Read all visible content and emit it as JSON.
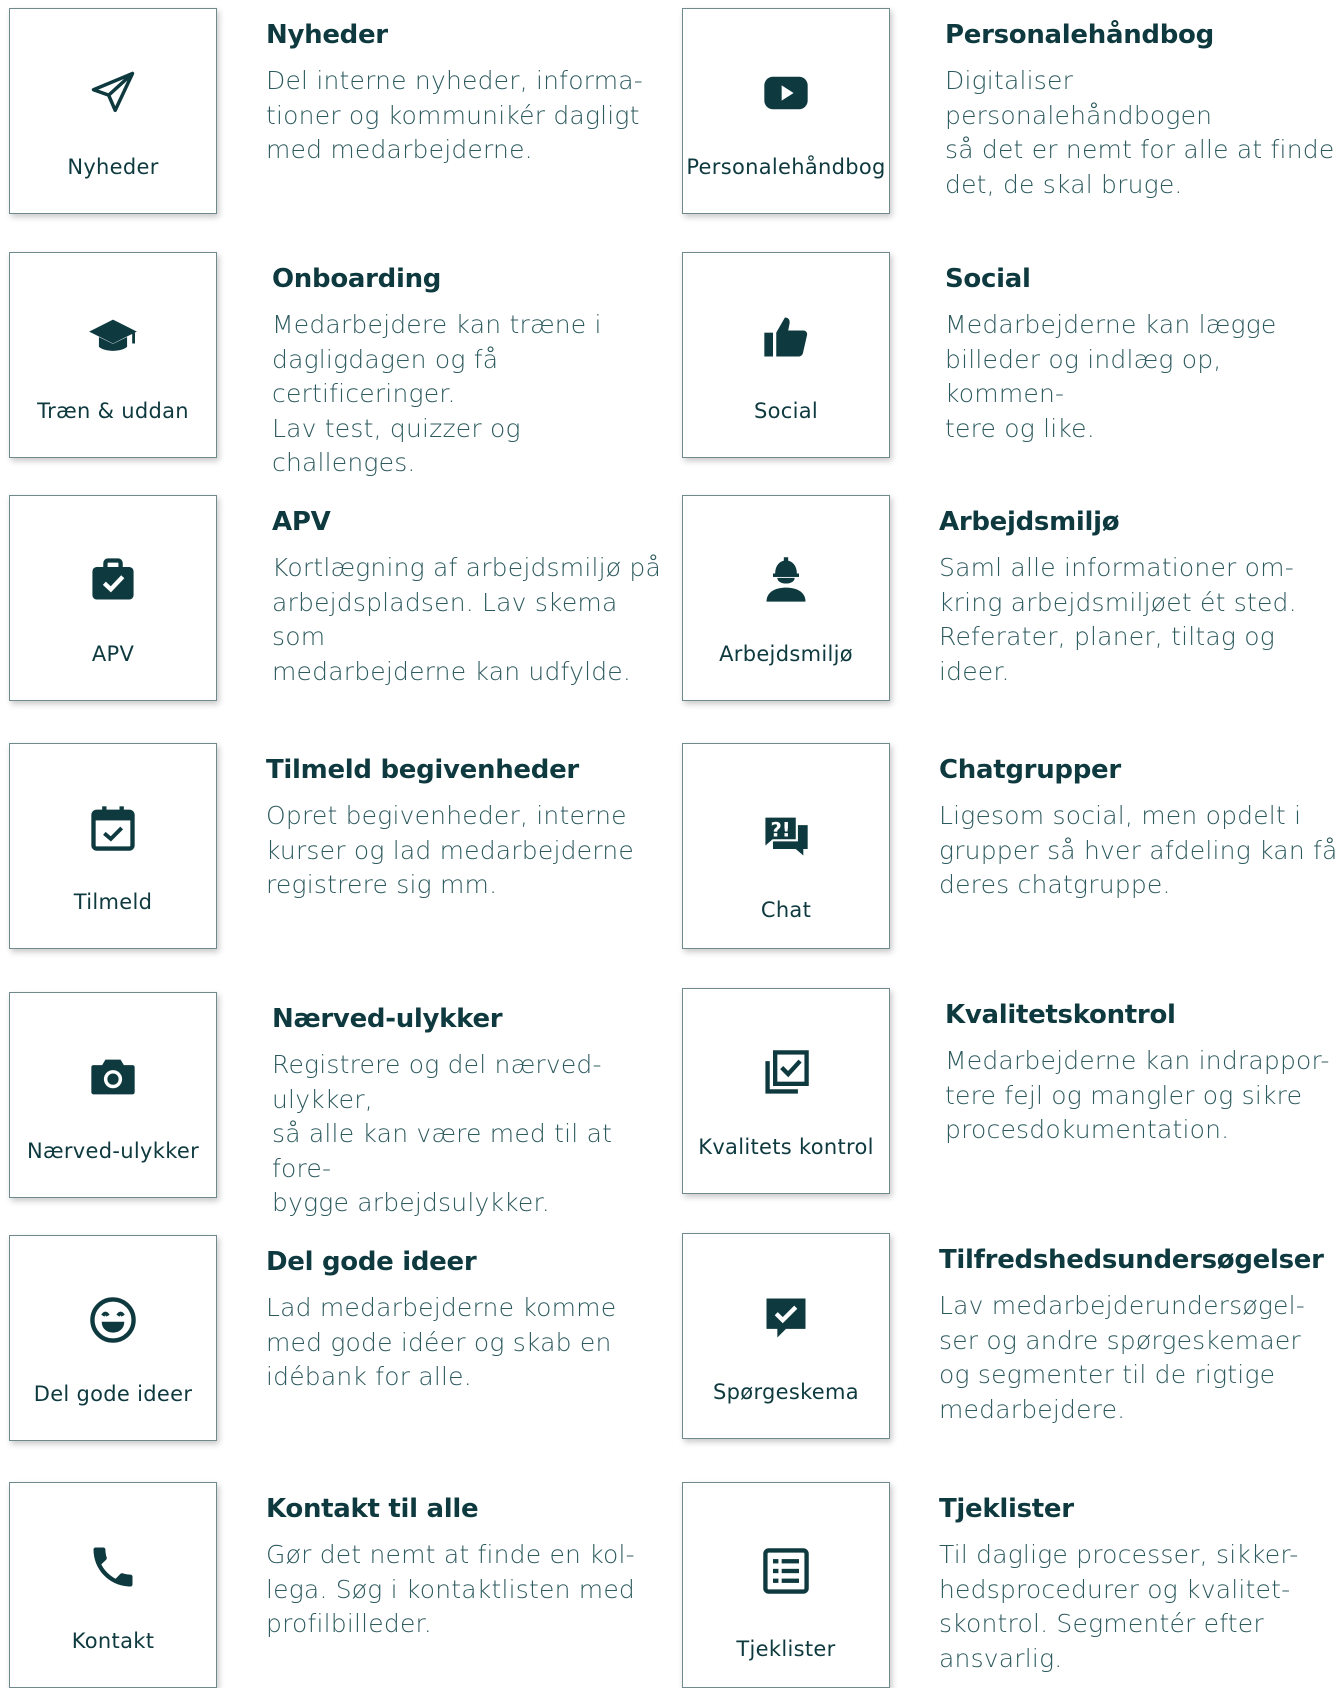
{
  "features": [
    {
      "card_label": "Nyheder",
      "title": "Nyheder",
      "desc": [
        "Del interne nyheder, informa-",
        "tioner og kommunikér dagligt",
        "med medarbejderne."
      ],
      "icon": "paper-plane-icon"
    },
    {
      "card_label": "Personalehåndbog",
      "title": "Personalehåndbog",
      "desc": [
        "Digitaliser personalehåndbogen",
        "så det er nemt for alle at finde",
        "det, de skal bruge."
      ],
      "icon": "video-play-icon"
    },
    {
      "card_label": "Træn & uddan",
      "title": "Onboarding",
      "desc": [
        "Medarbejdere kan træne i",
        "dagligdagen og få certificeringer.",
        "Lav test, quizzer og challenges."
      ],
      "icon": "graduation-cap-icon"
    },
    {
      "card_label": "Social",
      "title": "Social",
      "desc": [
        "Medarbejderne kan lægge",
        "billeder og indlæg op, kommen-",
        "tere og like."
      ],
      "icon": "thumbs-up-icon"
    },
    {
      "card_label": "APV",
      "title": "APV",
      "desc": [
        "Kortlægning af arbejdsmiljø på",
        "arbejdspladsen. Lav skema som",
        "medarbejderne kan udfylde."
      ],
      "icon": "briefcase-check-icon"
    },
    {
      "card_label": "Arbejdsmiljø",
      "title": "Arbejdsmiljø",
      "desc": [
        "Saml alle informationer om-",
        "kring arbejdsmiljøet ét sted.",
        "Referater, planer, tiltag og",
        "ideer."
      ],
      "icon": "hard-hat-worker-icon"
    },
    {
      "card_label": "Tilmeld",
      "title": "Tilmeld begivenheder",
      "desc": [
        "Opret begivenheder, interne",
        "kurser og lad medarbejderne",
        "registrere sig mm."
      ],
      "icon": "calendar-check-icon"
    },
    {
      "card_label": "Chat",
      "title": "Chatgrupper",
      "desc": [
        "Ligesom social, men opdelt i",
        "grupper så hver afdeling kan få",
        "deres chatgruppe."
      ],
      "icon": "chat-question-icon"
    },
    {
      "card_label": "Nærved-ulykker",
      "title": "Nærved-ulykker",
      "desc": [
        "Registrere og del nærved-ulykker,",
        "så alle kan være med til at fore-",
        "bygge arbejdsulykker."
      ],
      "icon": "camera-icon"
    },
    {
      "card_label": "Kvalitets kontrol",
      "title": "Kvalitetskontrol",
      "desc": [
        "Medarbejderne kan indrappor-",
        "tere fejl og mangler og sikre",
        "procesdokumentation."
      ],
      "icon": "checkbox-stack-icon"
    },
    {
      "card_label": "Del gode ideer",
      "title": "Del gode ideer",
      "desc": [
        "Lad medarbejderne komme",
        "med gode idéer og skab en",
        "idébank for alle."
      ],
      "icon": "smiley-icon"
    },
    {
      "card_label": "Spørgeskema",
      "title": "Tilfredshedsundersøgelser",
      "desc": [
        "Lav medarbejderundersøgel-",
        "ser og andre spørgeskemaer",
        "og segmenter til de rigtige",
        "medarbejdere."
      ],
      "icon": "chat-check-icon"
    },
    {
      "card_label": "Kontakt",
      "title": "Kontakt til alle",
      "desc": [
        "Gør det nemt at finde en kol-",
        "lega. Søg i kontaktlisten med",
        "profilbilleder."
      ],
      "icon": "phone-icon"
    },
    {
      "card_label": "Tjeklister",
      "title": "Tjeklister",
      "desc": [
        "Til daglige processer, sikker-",
        "hedsprocedurer og kvalitet-",
        "skontrol. Segmentér efter",
        "ansvarlig."
      ],
      "icon": "list-icon"
    }
  ]
}
